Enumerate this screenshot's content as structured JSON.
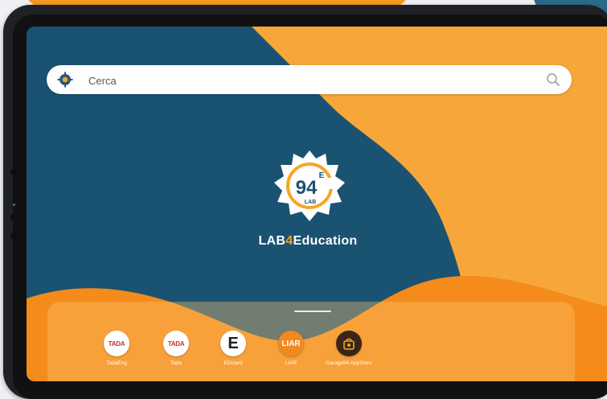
{
  "search": {
    "placeholder": "Cerca"
  },
  "brand": {
    "prefix": "LAB",
    "number": "4",
    "suffix": "Education",
    "logo_number": "94",
    "logo_letter": "E",
    "logo_sub": "LAB"
  },
  "dock": {
    "apps": [
      {
        "name": "TadaEng",
        "icon_text": "TADA"
      },
      {
        "name": "Tada",
        "icon_text": "TADA"
      },
      {
        "name": "EDUard",
        "icon_text": "E"
      },
      {
        "name": "LIAR",
        "icon_text": "LIAR"
      },
      {
        "name": "Garage94 AppStore",
        "icon_text": ""
      }
    ]
  },
  "colors": {
    "wallpaper_blue": "#1a5272",
    "wallpaper_orange": "#f7a63a",
    "wallpaper_deep_orange": "#f48b1a",
    "accent": "#f5a623"
  }
}
